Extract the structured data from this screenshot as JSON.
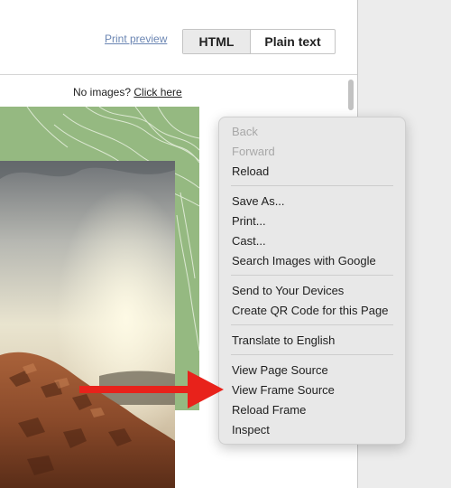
{
  "toolbar": {
    "print_preview": "Print preview",
    "html_label": "HTML",
    "plain_text_label": "Plain text"
  },
  "notice": {
    "prefix": "No images? ",
    "link": "Click here"
  },
  "context_menu": {
    "groups": [
      [
        {
          "label": "Back",
          "enabled": false
        },
        {
          "label": "Forward",
          "enabled": false
        },
        {
          "label": "Reload",
          "enabled": true
        }
      ],
      [
        {
          "label": "Save As...",
          "enabled": true
        },
        {
          "label": "Print...",
          "enabled": true
        },
        {
          "label": "Cast...",
          "enabled": true
        },
        {
          "label": "Search Images with Google",
          "enabled": true
        }
      ],
      [
        {
          "label": "Send to Your Devices",
          "enabled": true
        },
        {
          "label": "Create QR Code for this Page",
          "enabled": true
        }
      ],
      [
        {
          "label": "Translate to English",
          "enabled": true
        }
      ],
      [
        {
          "label": "View Page Source",
          "enabled": true
        },
        {
          "label": "View Frame Source",
          "enabled": true
        },
        {
          "label": "Reload Frame",
          "enabled": true
        },
        {
          "label": "Inspect",
          "enabled": true
        }
      ]
    ]
  },
  "colors": {
    "banner_green": "#95b981",
    "arrow_red": "#e8221b",
    "link_blue": "#6b86b3"
  }
}
